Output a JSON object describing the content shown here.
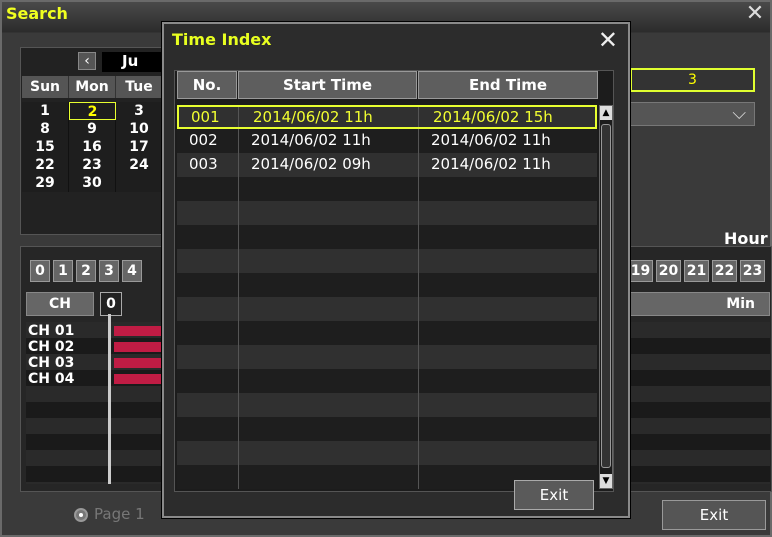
{
  "search": {
    "title": "Search",
    "calendar": {
      "month_label": "Ju",
      "weekdays": [
        "Sun",
        "Mon",
        "Tue"
      ],
      "weeks": [
        [
          "1",
          "2",
          "3"
        ],
        [
          "8",
          "9",
          "10"
        ],
        [
          "15",
          "16",
          "17"
        ],
        [
          "22",
          "23",
          "24"
        ],
        [
          "29",
          "30",
          ""
        ]
      ],
      "selected_day": "2"
    },
    "channel_field_value": "3",
    "hour_label": "Hour",
    "hours_left": [
      "0",
      "1",
      "2",
      "3",
      "4"
    ],
    "hours_right": [
      "19",
      "20",
      "21",
      "22",
      "23"
    ],
    "ch_header": "CH",
    "ch_zero": "0",
    "min_label": "Min",
    "channels": [
      "CH 01",
      "CH 02",
      "CH 03",
      "CH 04"
    ],
    "page_label": "Page 1",
    "exit_label": "Exit"
  },
  "time_index": {
    "title": "Time Index",
    "headers": {
      "no": "No.",
      "start": "Start Time",
      "end": "End Time"
    },
    "rows": [
      {
        "no": "001",
        "start": "2014/06/02 11h",
        "end": "2014/06/02 15h",
        "selected": true
      },
      {
        "no": "002",
        "start": "2014/06/02 11h",
        "end": "2014/06/02 11h",
        "selected": false
      },
      {
        "no": "003",
        "start": "2014/06/02 09h",
        "end": "2014/06/02 11h",
        "selected": false
      }
    ],
    "exit_label": "Exit"
  },
  "colors": {
    "title_yellow": "#e8ff20",
    "record_bar": "#c01c44"
  },
  "icons": {
    "close": "close-icon",
    "prev": "chevron-left-icon",
    "dropdown": "chevron-down-icon",
    "scroll_up": "scroll-up-icon",
    "scroll_down": "scroll-down-icon"
  }
}
